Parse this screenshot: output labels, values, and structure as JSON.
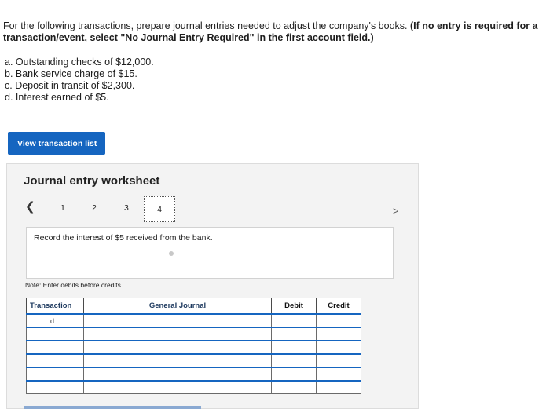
{
  "instructions": {
    "text": "For the following transactions, prepare journal entries needed to adjust the company's books. ",
    "bold_text": "(If no entry is required for a transaction/event, select \"No Journal Entry Required\" in the first account field.)"
  },
  "transactions": [
    "a. Outstanding checks of $12,000.",
    "b. Bank service charge of $15.",
    "c. Deposit in transit of $2,300.",
    "d. Interest earned of $5."
  ],
  "view_button_label": "View transaction list",
  "worksheet": {
    "title": "Journal entry worksheet",
    "pages": [
      "1",
      "2",
      "3",
      "4"
    ],
    "current_page": "4",
    "prev_icon": "chevron-left-icon",
    "next_icon": "chevron-right-icon",
    "prompt": "Record the interest of $5 received from the bank.",
    "note": "Note: Enter debits before credits.",
    "table": {
      "headers": [
        "Transaction",
        "General Journal",
        "Debit",
        "Credit"
      ],
      "rows": [
        [
          "d.",
          "",
          "",
          ""
        ],
        [
          "",
          "",
          "",
          ""
        ],
        [
          "",
          "",
          "",
          ""
        ],
        [
          "",
          "",
          "",
          ""
        ],
        [
          "",
          "",
          "",
          ""
        ],
        [
          "",
          "",
          "",
          ""
        ]
      ]
    }
  },
  "colors": {
    "accent": "#1565c0",
    "panel_bg": "#f3f3f3"
  }
}
